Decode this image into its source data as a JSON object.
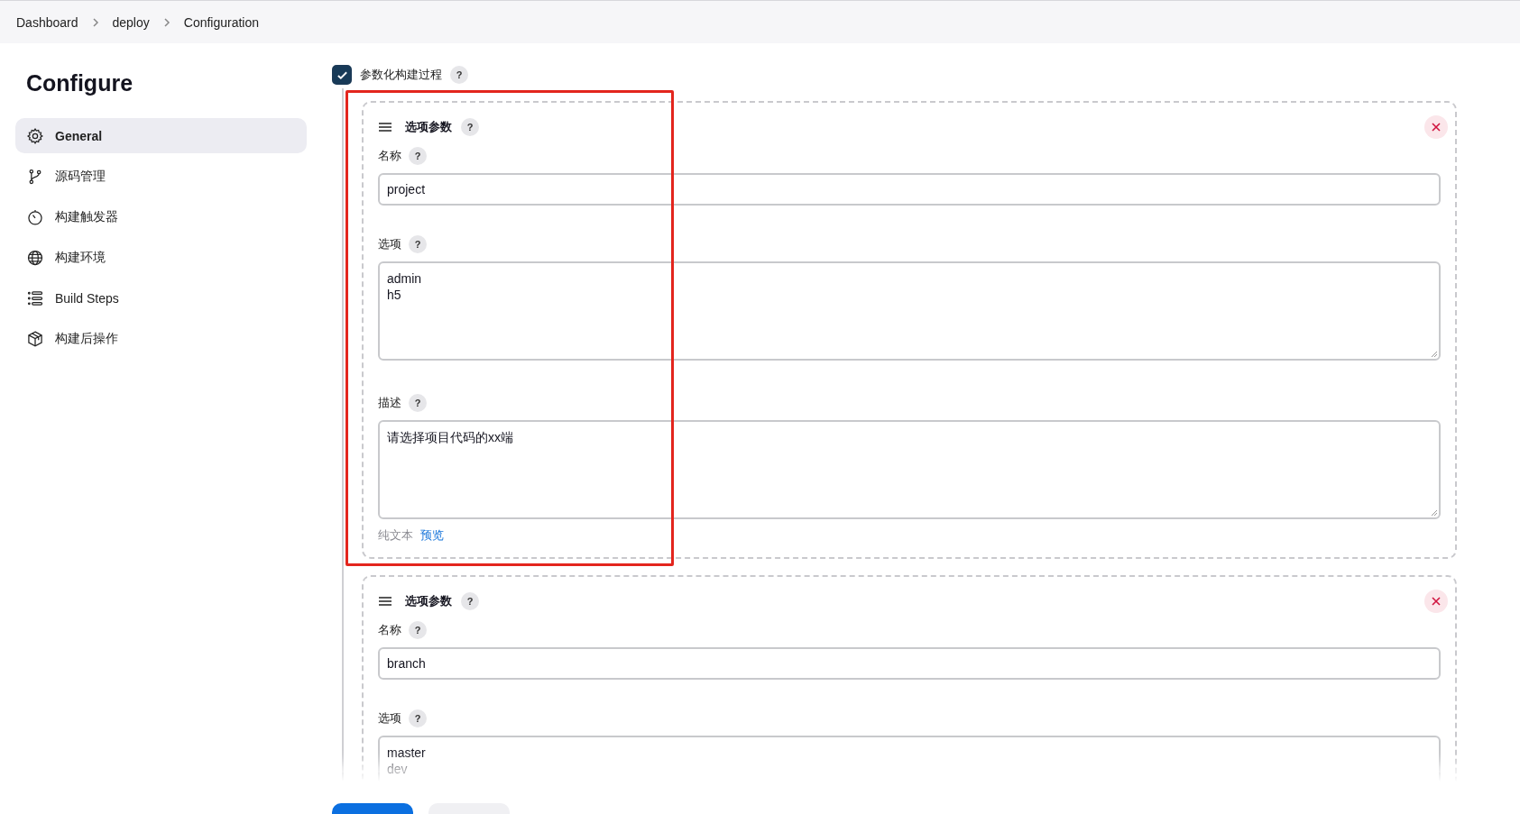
{
  "breadcrumb": [
    "Dashboard",
    "deploy",
    "Configuration"
  ],
  "sidebar": {
    "title": "Configure",
    "items": [
      {
        "label": "General",
        "kind": "gear",
        "selected": true
      },
      {
        "label": "源码管理",
        "kind": "branch",
        "selected": false
      },
      {
        "label": "构建触发器",
        "kind": "timer",
        "selected": false
      },
      {
        "label": "构建环境",
        "kind": "globe",
        "selected": false
      },
      {
        "label": "Build Steps",
        "kind": "list",
        "selected": false
      },
      {
        "label": "构建后操作",
        "kind": "box",
        "selected": false
      }
    ]
  },
  "parameterized": {
    "label": "参数化构建过程",
    "help": "?",
    "checked": true
  },
  "parameters": [
    {
      "title": "选项参数",
      "help": "?",
      "highlighted": true,
      "fields": [
        {
          "kind": "text",
          "label": "名称",
          "help": "?",
          "value": "project"
        },
        {
          "kind": "textarea",
          "label": "选项",
          "help": "?",
          "value": "admin\nh5"
        },
        {
          "kind": "textarea",
          "label": "描述",
          "help": "?",
          "value": "请选择项目代码的xx端"
        }
      ],
      "format": {
        "label": "纯文本",
        "link": "预览"
      }
    },
    {
      "title": "选项参数",
      "help": "?",
      "highlighted": false,
      "fields": [
        {
          "kind": "text",
          "label": "名称",
          "help": "?",
          "value": "branch"
        },
        {
          "kind": "textarea",
          "label": "选项",
          "help": "?",
          "value": "master\ndev"
        }
      ]
    }
  ]
}
